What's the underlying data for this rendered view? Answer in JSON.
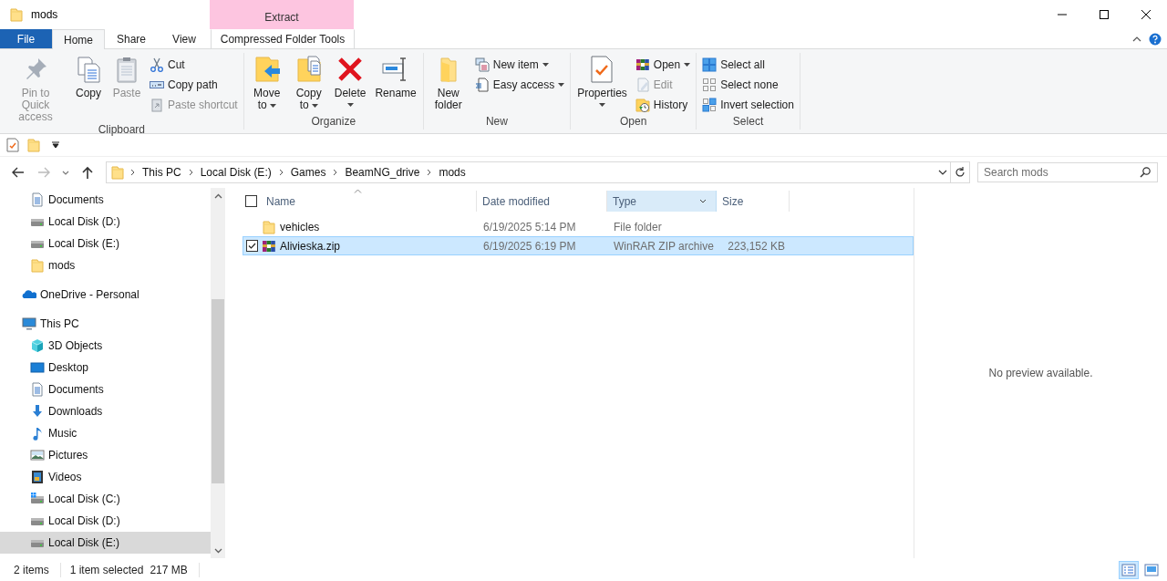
{
  "window": {
    "title": "mods"
  },
  "contextual_header": "Extract",
  "ribbon_tabs": [
    {
      "label": "File",
      "kind": "file",
      "selected": false
    },
    {
      "label": "Home",
      "kind": "normal",
      "selected": true
    },
    {
      "label": "Share",
      "kind": "normal",
      "selected": false
    },
    {
      "label": "View",
      "kind": "normal",
      "selected": false
    },
    {
      "label": "Compressed Folder Tools",
      "kind": "contextual",
      "selected": false
    }
  ],
  "ribbon_groups": [
    {
      "label": "Clipboard",
      "commands": [
        {
          "label": "Pin to Quick access",
          "kind": "large",
          "disabled": true,
          "dropdown": false
        },
        {
          "label": "Copy",
          "kind": "large",
          "disabled": false,
          "dropdown": false
        },
        {
          "label": "Paste",
          "kind": "large",
          "disabled": true,
          "dropdown": false
        },
        {
          "label": "Cut",
          "kind": "small",
          "disabled": false,
          "dropdown": false
        },
        {
          "label": "Copy path",
          "kind": "small",
          "disabled": false,
          "dropdown": false
        },
        {
          "label": "Paste shortcut",
          "kind": "small",
          "disabled": true,
          "dropdown": false
        }
      ]
    },
    {
      "label": "Organize",
      "commands": [
        {
          "label": "Move to",
          "kind": "large",
          "disabled": false,
          "dropdown": true
        },
        {
          "label": "Copy to",
          "kind": "large",
          "disabled": false,
          "dropdown": true
        },
        {
          "label": "Delete",
          "kind": "large",
          "disabled": false,
          "dropdown": true
        },
        {
          "label": "Rename",
          "kind": "large",
          "disabled": false,
          "dropdown": false
        }
      ]
    },
    {
      "label": "New",
      "commands": [
        {
          "label": "New folder",
          "kind": "large",
          "disabled": false,
          "dropdown": false
        },
        {
          "label": "New item",
          "kind": "small",
          "disabled": false,
          "dropdown": true
        },
        {
          "label": "Easy access",
          "kind": "small",
          "disabled": false,
          "dropdown": true
        }
      ]
    },
    {
      "label": "Open",
      "commands": [
        {
          "label": "Properties",
          "kind": "large",
          "disabled": false,
          "dropdown": true
        },
        {
          "label": "Open",
          "kind": "small",
          "disabled": false,
          "dropdown": true
        },
        {
          "label": "Edit",
          "kind": "small",
          "disabled": true,
          "dropdown": false
        },
        {
          "label": "History",
          "kind": "small",
          "disabled": false,
          "dropdown": false
        }
      ]
    },
    {
      "label": "Select",
      "commands": [
        {
          "label": "Select all",
          "kind": "small",
          "disabled": false,
          "dropdown": false
        },
        {
          "label": "Select none",
          "kind": "small",
          "disabled": false,
          "dropdown": false
        },
        {
          "label": "Invert selection",
          "kind": "small",
          "disabled": false,
          "dropdown": false
        }
      ]
    }
  ],
  "address_bar": {
    "crumbs": [
      "This PC",
      "Local Disk (E:)",
      "Games",
      "BeamNG_drive",
      "mods"
    ]
  },
  "search": {
    "placeholder": "Search mods"
  },
  "navigation_pane": {
    "quick_access_items": [
      {
        "label": "Documents",
        "kind": "documents",
        "selected": false
      },
      {
        "label": "Local Disk (D:)",
        "kind": "drive",
        "selected": false
      },
      {
        "label": "Local Disk (E:)",
        "kind": "drive",
        "selected": false
      },
      {
        "label": "mods",
        "kind": "folder",
        "selected": false
      }
    ],
    "tree": [
      {
        "label": "OneDrive - Personal",
        "kind": "onedrive",
        "selected": false
      },
      {
        "label": "This PC",
        "kind": "pc",
        "selected": false,
        "children": [
          {
            "label": "3D Objects",
            "kind": "objects3d",
            "selected": false
          },
          {
            "label": "Desktop",
            "kind": "desktop",
            "selected": false
          },
          {
            "label": "Documents",
            "kind": "documents",
            "selected": false
          },
          {
            "label": "Downloads",
            "kind": "downloads",
            "selected": false
          },
          {
            "label": "Music",
            "kind": "music",
            "selected": false
          },
          {
            "label": "Pictures",
            "kind": "pictures",
            "selected": false
          },
          {
            "label": "Videos",
            "kind": "videos",
            "selected": false
          },
          {
            "label": "Local Disk (C:)",
            "kind": "systemdrive",
            "selected": false
          },
          {
            "label": "Local Disk (D:)",
            "kind": "drive",
            "selected": false
          },
          {
            "label": "Local Disk (E:)",
            "kind": "drive",
            "selected": true
          }
        ]
      }
    ]
  },
  "file_list": {
    "columns": [
      {
        "label": "Name",
        "sorted": true,
        "highlighted": false
      },
      {
        "label": "Date modified",
        "sorted": false,
        "highlighted": false
      },
      {
        "label": "Type",
        "sorted": false,
        "highlighted": true
      },
      {
        "label": "Size",
        "sorted": false,
        "highlighted": false
      }
    ],
    "rows": [
      {
        "name": "vehicles",
        "kind": "folder",
        "date_modified": "6/19/2025 5:14 PM",
        "type": "File folder",
        "size": "",
        "selected": false,
        "checked": false
      },
      {
        "name": "Alivieska.zip",
        "kind": "archive",
        "date_modified": "6/19/2025 6:19 PM",
        "type": "WinRAR ZIP archive",
        "size": "223,152 KB",
        "selected": true,
        "checked": true
      }
    ]
  },
  "preview_pane": {
    "message": "No preview available."
  },
  "status_bar": {
    "item_count": "2 items",
    "selection": "1 item selected",
    "selection_size": "217 MB"
  },
  "view_buttons": [
    {
      "kind": "details",
      "selected": true
    },
    {
      "kind": "large_icons",
      "selected": false
    }
  ]
}
